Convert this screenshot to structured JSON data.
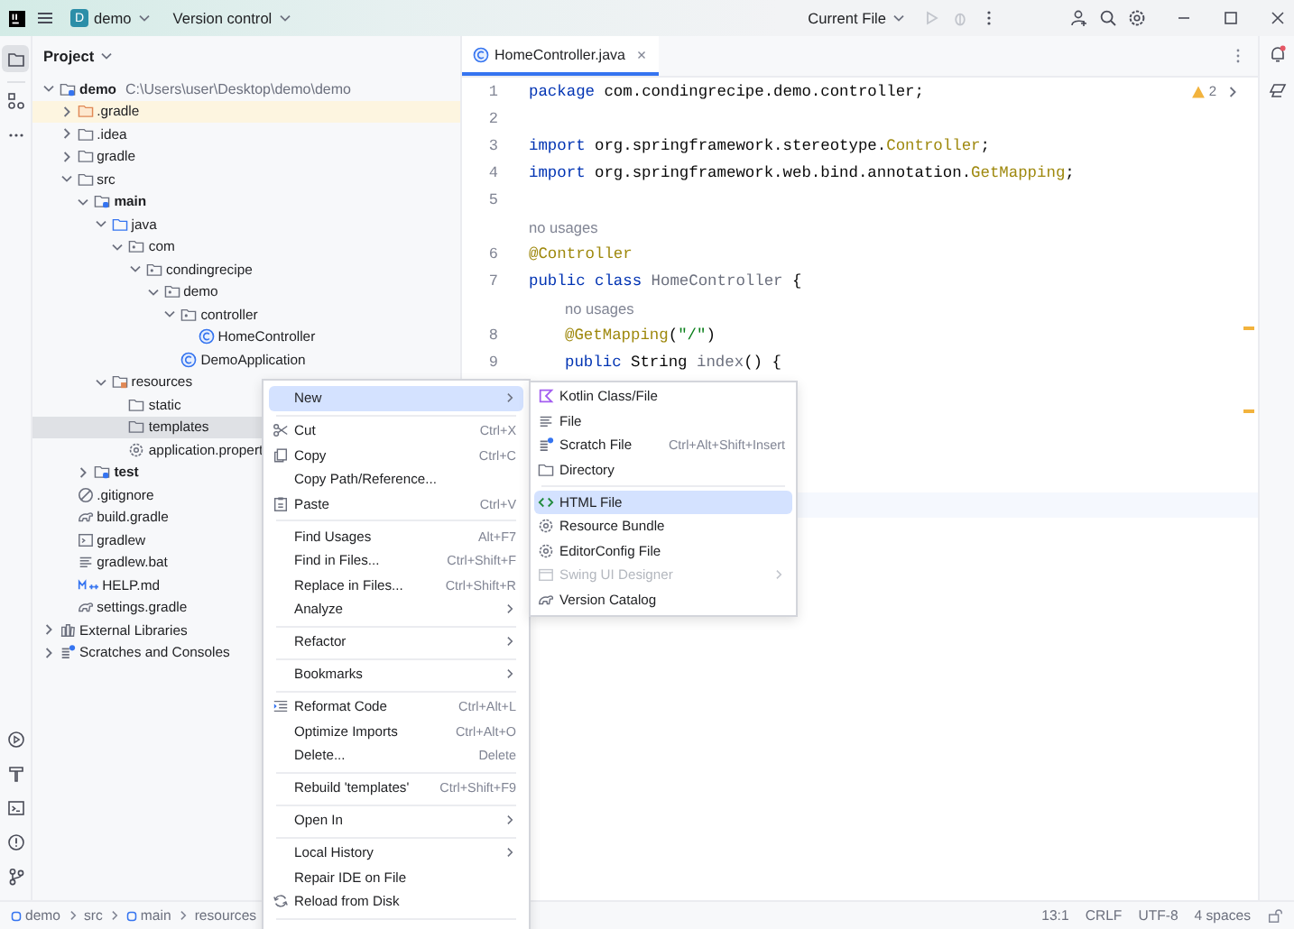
{
  "title_bar": {
    "project_badge": "D",
    "project": "demo",
    "vcs": "Version control",
    "run_config": "Current File"
  },
  "project_panel": {
    "title": "Project",
    "tree": [
      {
        "label": "demo",
        "path": "C:\\Users\\user\\Desktop\\demo\\demo",
        "kind": "module",
        "bold": true,
        "expanded": true,
        "selected": false,
        "children": [
          {
            "label": ".gradle",
            "kind": "excluded",
            "expanded": false,
            "selected": false
          },
          {
            "label": ".idea",
            "kind": "folder",
            "expanded": false,
            "selected": false
          },
          {
            "label": "gradle",
            "kind": "folder",
            "expanded": false,
            "selected": false
          },
          {
            "label": "src",
            "kind": "folder",
            "expanded": true,
            "selected": false,
            "children": [
              {
                "label": "main",
                "kind": "module",
                "bold": true,
                "expanded": true,
                "selected": false,
                "children": [
                  {
                    "label": "java",
                    "kind": "source",
                    "expanded": true,
                    "selected": false,
                    "children": [
                      {
                        "label": "com",
                        "kind": "package",
                        "expanded": true,
                        "selected": false,
                        "children": [
                          {
                            "label": "condingrecipe",
                            "kind": "package",
                            "expanded": true,
                            "selected": false,
                            "children": [
                              {
                                "label": "demo",
                                "kind": "package",
                                "expanded": true,
                                "selected": false,
                                "children": [
                                  {
                                    "label": "controller",
                                    "kind": "package",
                                    "expanded": true,
                                    "selected": false,
                                    "children": [
                                      {
                                        "label": "HomeController",
                                        "kind": "class",
                                        "selected": false
                                      }
                                    ]
                                  },
                                  {
                                    "label": "DemoApplication",
                                    "kind": "class",
                                    "selected": false
                                  }
                                ]
                              }
                            ]
                          }
                        ]
                      }
                    ]
                  },
                  {
                    "label": "resources",
                    "kind": "resources",
                    "expanded": true,
                    "selected": false,
                    "children": [
                      {
                        "label": "static",
                        "kind": "folder",
                        "selected": false
                      },
                      {
                        "label": "templates",
                        "kind": "folder",
                        "selected": true
                      },
                      {
                        "label": "application.propert",
                        "kind": "settings",
                        "selected": false
                      }
                    ]
                  }
                ]
              },
              {
                "label": "test",
                "kind": "module",
                "bold": true,
                "expanded": false,
                "selected": false
              }
            ]
          },
          {
            "label": ".gitignore",
            "kind": "ignore",
            "selected": false
          },
          {
            "label": "build.gradle",
            "kind": "gradle",
            "selected": false
          },
          {
            "label": "gradlew",
            "kind": "script",
            "selected": false
          },
          {
            "label": "gradlew.bat",
            "kind": "text",
            "selected": false
          },
          {
            "label": "HELP.md",
            "kind": "markdown",
            "selected": false
          },
          {
            "label": "settings.gradle",
            "kind": "gradle",
            "selected": false
          }
        ]
      },
      {
        "label": "External Libraries",
        "kind": "library",
        "expanded": false,
        "selected": false
      },
      {
        "label": "Scratches and Consoles",
        "kind": "scratch",
        "expanded": false,
        "selected": false
      }
    ]
  },
  "editor": {
    "tab": "HomeController.java",
    "warnings": "2",
    "lines": [
      {
        "kind": "code",
        "number": "1",
        "tokens": [
          {
            "text": "package",
            "kind": "keyword"
          },
          {
            "text": " com.condingrecipe.demo.controller;",
            "kind": "plain"
          }
        ]
      },
      {
        "kind": "code",
        "number": "2"
      },
      {
        "kind": "code",
        "number": "3",
        "tokens": [
          {
            "text": "import",
            "kind": "keyword"
          },
          {
            "text": " org.springframework.stereotype.",
            "kind": "plain"
          },
          {
            "text": "Controller",
            "kind": "annotation"
          },
          {
            "text": ";",
            "kind": "plain"
          }
        ]
      },
      {
        "kind": "code",
        "number": "4",
        "tokens": [
          {
            "text": "import",
            "kind": "keyword"
          },
          {
            "text": " org.springframework.web.bind.annotation.",
            "kind": "plain"
          },
          {
            "text": "GetMapping",
            "kind": "annotation"
          },
          {
            "text": ";",
            "kind": "plain"
          }
        ]
      },
      {
        "kind": "code",
        "number": "5"
      },
      {
        "kind": "hint",
        "text": "no usages"
      },
      {
        "kind": "code",
        "number": "6",
        "tokens": [
          {
            "text": "@Controller",
            "kind": "annotation"
          }
        ]
      },
      {
        "kind": "code",
        "number": "7",
        "tokens": [
          {
            "text": "public class",
            "kind": "keyword"
          },
          {
            "text": " HomeController",
            "kind": "unused"
          },
          {
            "text": " {",
            "kind": "plain"
          }
        ],
        "children": [
          {
            "kind": "hint",
            "text": "no usages"
          },
          {
            "kind": "code",
            "number": "8",
            "tokens": [
              {
                "text": "@GetMapping",
                "kind": "annotation"
              },
              {
                "text": "(",
                "kind": "plain"
              },
              {
                "text": "\"/\"",
                "kind": "string"
              },
              {
                "text": ")",
                "kind": "plain"
              }
            ]
          },
          {
            "kind": "code",
            "number": "9",
            "tokens": [
              {
                "text": "public",
                "kind": "keyword"
              },
              {
                "text": " String ",
                "kind": "plain"
              },
              {
                "text": "index",
                "kind": "unused"
              },
              {
                "text": "() {",
                "kind": "plain"
              }
            ]
          }
        ]
      }
    ]
  },
  "context_menu": {
    "items": [
      {
        "kind": "item",
        "label": "New",
        "submenu": true,
        "selected": true
      },
      {
        "kind": "separator"
      },
      {
        "kind": "item",
        "label": "Cut",
        "shortcut": "Ctrl+X",
        "submenu": false,
        "selected": false
      },
      {
        "kind": "item",
        "label": "Copy",
        "shortcut": "Ctrl+C",
        "submenu": false,
        "selected": false
      },
      {
        "kind": "item",
        "label": "Copy Path/Reference...",
        "submenu": false,
        "selected": false
      },
      {
        "kind": "item",
        "label": "Paste",
        "shortcut": "Ctrl+V",
        "submenu": false,
        "selected": false
      },
      {
        "kind": "separator"
      },
      {
        "kind": "item",
        "label": "Find Usages",
        "shortcut": "Alt+F7",
        "submenu": false,
        "selected": false
      },
      {
        "kind": "item",
        "label": "Find in Files...",
        "shortcut": "Ctrl+Shift+F",
        "submenu": false,
        "selected": false
      },
      {
        "kind": "item",
        "label": "Replace in Files...",
        "shortcut": "Ctrl+Shift+R",
        "submenu": false,
        "selected": false
      },
      {
        "kind": "item",
        "label": "Analyze",
        "submenu": true,
        "selected": false
      },
      {
        "kind": "separator"
      },
      {
        "kind": "item",
        "label": "Refactor",
        "submenu": true,
        "selected": false
      },
      {
        "kind": "separator"
      },
      {
        "kind": "item",
        "label": "Bookmarks",
        "submenu": true,
        "selected": false
      },
      {
        "kind": "separator"
      },
      {
        "kind": "item",
        "label": "Reformat Code",
        "shortcut": "Ctrl+Alt+L",
        "submenu": false,
        "selected": false
      },
      {
        "kind": "item",
        "label": "Optimize Imports",
        "shortcut": "Ctrl+Alt+O",
        "submenu": false,
        "selected": false
      },
      {
        "kind": "item",
        "label": "Delete...",
        "shortcut": "Delete",
        "submenu": false,
        "selected": false
      },
      {
        "kind": "separator"
      },
      {
        "kind": "item",
        "label": "Rebuild 'templates'",
        "shortcut": "Ctrl+Shift+F9",
        "submenu": false,
        "selected": false
      },
      {
        "kind": "separator"
      },
      {
        "kind": "item",
        "label": "Open In",
        "submenu": true,
        "selected": false
      },
      {
        "kind": "separator"
      },
      {
        "kind": "item",
        "label": "Local History",
        "submenu": true,
        "selected": false
      },
      {
        "kind": "item",
        "label": "Repair IDE on File",
        "submenu": false,
        "selected": false
      },
      {
        "kind": "item",
        "label": "Reload from Disk",
        "submenu": false,
        "selected": false
      },
      {
        "kind": "separator"
      }
    ]
  },
  "new_submenu": {
    "items": [
      {
        "kind": "item",
        "label": "Kotlin Class/File",
        "submenu": false,
        "selected": false,
        "disabled": false
      },
      {
        "kind": "item",
        "label": "File",
        "submenu": false,
        "selected": false,
        "disabled": false
      },
      {
        "kind": "item",
        "label": "Scratch File",
        "shortcut": "Ctrl+Alt+Shift+Insert",
        "submenu": false,
        "selected": false,
        "disabled": false
      },
      {
        "kind": "item",
        "label": "Directory",
        "submenu": false,
        "selected": false,
        "disabled": false
      },
      {
        "kind": "separator"
      },
      {
        "kind": "item",
        "label": "HTML File",
        "submenu": false,
        "selected": true,
        "disabled": false
      },
      {
        "kind": "item",
        "label": "Resource Bundle",
        "submenu": false,
        "selected": false,
        "disabled": false
      },
      {
        "kind": "item",
        "label": "EditorConfig File",
        "submenu": false,
        "selected": false,
        "disabled": false
      },
      {
        "kind": "item",
        "label": "Swing UI Designer",
        "submenu": true,
        "selected": false,
        "disabled": true
      },
      {
        "kind": "item",
        "label": "Version Catalog",
        "submenu": false,
        "selected": false,
        "disabled": false
      }
    ]
  },
  "status_bar": {
    "breadcrumbs": [
      {
        "label": "demo",
        "kind": "module"
      },
      {
        "label": "src",
        "kind": "plain"
      },
      {
        "label": "main",
        "kind": "module"
      },
      {
        "label": "resources",
        "kind": "plain"
      }
    ],
    "items": [
      "13:1",
      "CRLF",
      "UTF-8",
      "4 spaces"
    ]
  }
}
